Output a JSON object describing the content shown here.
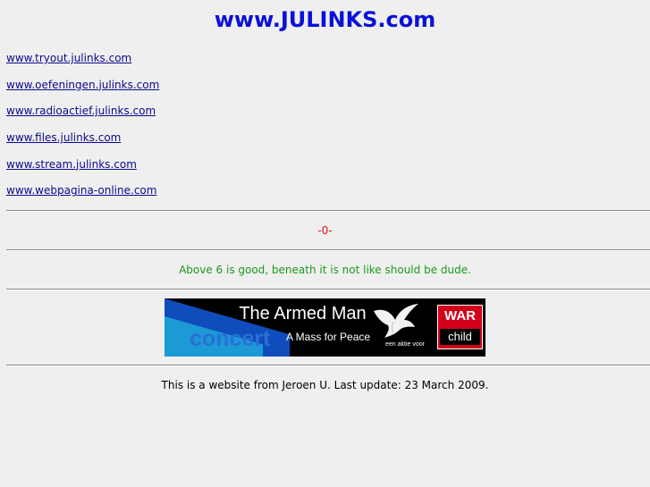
{
  "header": {
    "title": "www.JULINKS.com"
  },
  "links": [
    "www.tryout.julinks.com ",
    "www.oefeningen.julinks.com ",
    "www.radioactief.julinks.com ",
    "www.files.julinks.com ",
    "www.stream.julinks.com ",
    "www.webpagina-online.com "
  ],
  "counter": "-0-",
  "message": "Above 6 is good, beneath it is not like should be dude.",
  "banner": {
    "title": "The Armed Man",
    "concert": "concert",
    "subtitle": "A Mass for Peace",
    "aktie": "een aktie voor",
    "brand_top": "WAR",
    "brand_bottom": "child",
    "colors": {
      "brand_red": "#d3001a",
      "concert_blue": "#2a6fd6"
    }
  },
  "footer": "This is a website from Jeroen U. Last update: 23 March 2009.",
  "colors": {
    "background": "#efefef",
    "title": "#0a10d8",
    "link": "#0a0a8a",
    "counter": "#e01010",
    "message": "#1a9a1a"
  }
}
